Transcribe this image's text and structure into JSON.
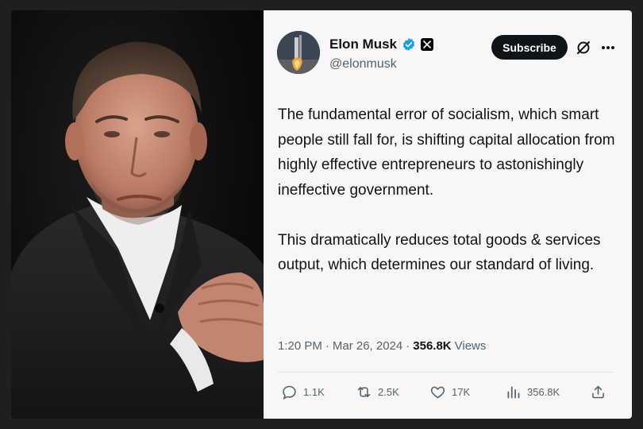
{
  "photo": {
    "alt": "portrait"
  },
  "tweet": {
    "author_name": "Elon Musk",
    "handle": "@elonmusk",
    "verified": true,
    "subscribe_label": "Subscribe",
    "paragraphs": [
      "The fundamental error of socialism, which smart people still fall for, is shifting capital allocation from highly effective entrepreneurs to astonishingly ineffective government.",
      "This dramatically reduces total goods & services output, which determines our standard of living."
    ],
    "time": "1:20 PM",
    "separator": "·",
    "date": "Mar 26, 2024",
    "views_count": "356.8K",
    "views_label": "Views"
  },
  "actions": {
    "replies": "1.1K",
    "reposts": "2.5K",
    "likes": "17K",
    "views": "356.8K"
  },
  "colors": {
    "accent_verified": "#1d9bf0",
    "button_bg": "#0f1419",
    "card_bg": "#f7f7f7",
    "muted_text": "#536471"
  },
  "icons": [
    "verified-badge-icon",
    "x-logo-icon",
    "grok-icon",
    "more-icon",
    "reply-icon",
    "repost-icon",
    "like-icon",
    "views-icon",
    "share-icon"
  ]
}
